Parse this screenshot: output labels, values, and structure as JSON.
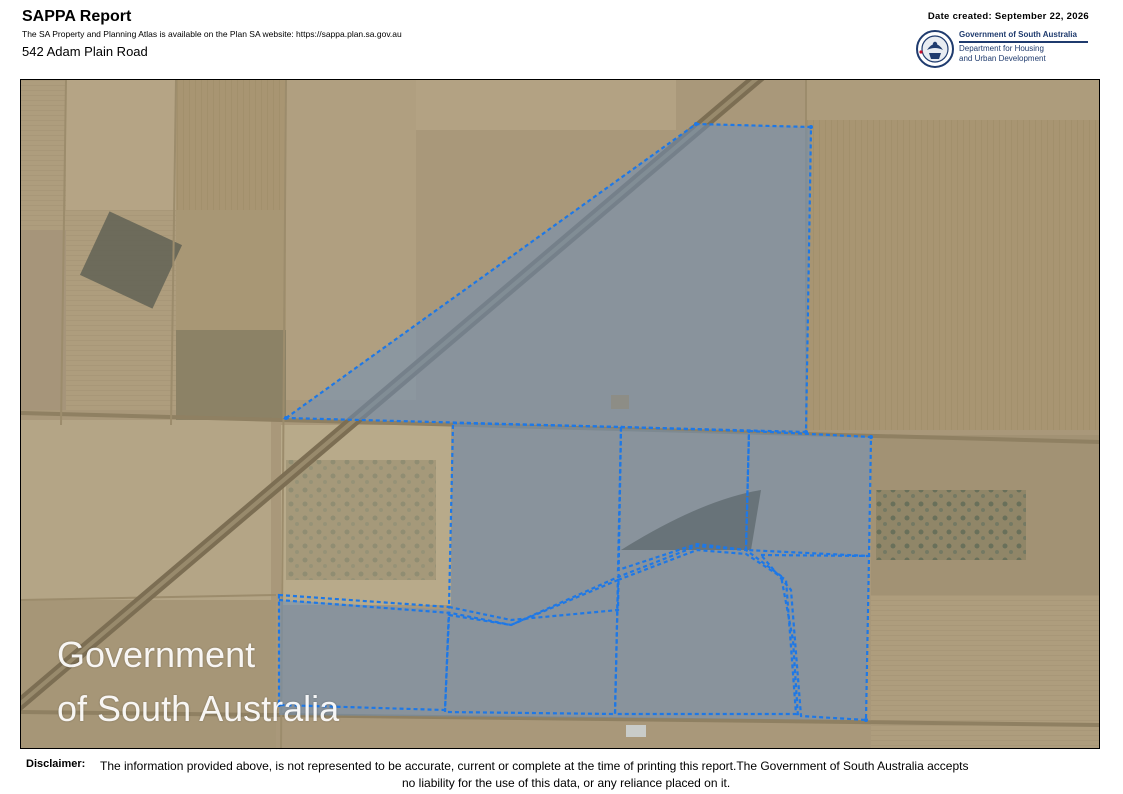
{
  "header": {
    "title": "SAPPA Report",
    "subtitle": "The SA Property and Planning Atlas is available on the Plan SA website: https://sappa.plan.sa.gov.au",
    "address": "542 Adam Plain Road",
    "date_created": "Date created: September 22, 2026"
  },
  "logo": {
    "line1": "Government of South Australia",
    "line2": "Department for Housing",
    "line3": "and Urban Development"
  },
  "map": {
    "watermark_line1": "Government",
    "watermark_line2": "of South Australia",
    "parcel_outline_color": "#1e78e6",
    "parcel_fill_color": "#6f8fb8"
  },
  "disclaimer": {
    "label": "Disclaimer:",
    "line1": "The information provided above, is not represented to be accurate, current or complete at the time of printing this report.The Government of South Australia accepts",
    "line2": "no liability for the use of this data, or any reliance placed on it."
  }
}
